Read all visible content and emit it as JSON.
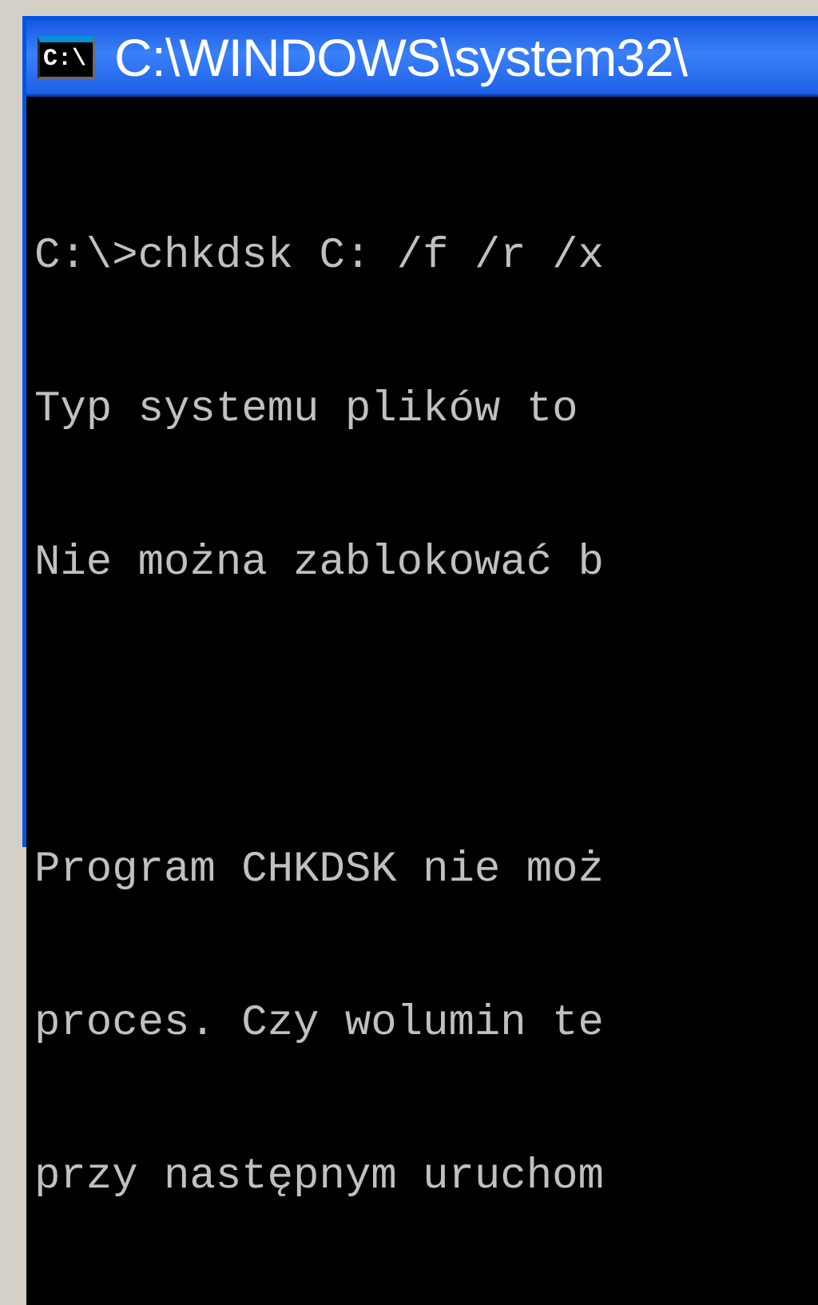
{
  "window": {
    "title": "C:\\WINDOWS\\system32\\",
    "icon_label": "C:\\"
  },
  "console": {
    "lines": [
      "C:\\>chkdsk C: /f /r /x",
      "Typ systemu plików to ",
      "Nie można zablokować b",
      "",
      "Program CHKDSK nie moż",
      "proces. Czy wolumin te",
      "przy następnym uruchom"
    ]
  }
}
